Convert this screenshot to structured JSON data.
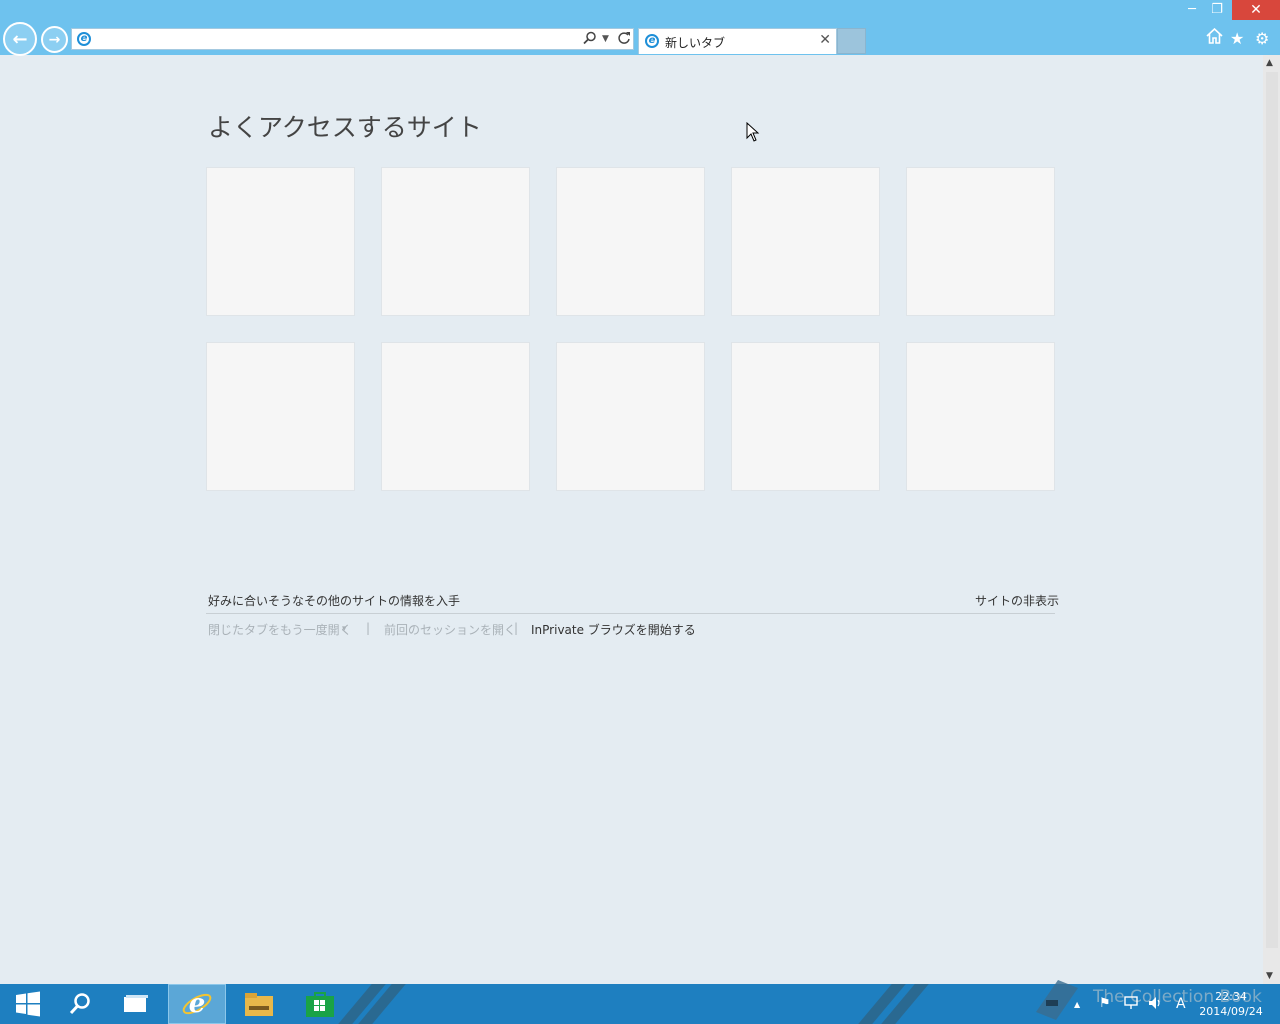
{
  "browser": {
    "address_value": "",
    "tab_title": "新しいタブ",
    "tab_close": "✕",
    "back": "←",
    "forward": "→",
    "search_icon": "search-icon",
    "refresh_icon": "refresh-icon"
  },
  "window": {
    "minimize": "─",
    "restore": "❐",
    "close": "✕"
  },
  "toolbar": {
    "home": "⌂",
    "favorites": "★",
    "settings": "⚙"
  },
  "page": {
    "heading": "よくアクセスするサイト",
    "tiles": [
      "",
      "",
      "",
      "",
      "",
      "",
      "",
      "",
      "",
      ""
    ],
    "more_sites": "好みに合いそうなその他のサイトの情報を入手",
    "hide_sites": "サイトの非表示",
    "reopen_closed": "閉じたタブをもう一度開く",
    "reopen_arrow": "▾",
    "reopen_session": "前回のセッションを開く",
    "inprivate": "InPrivate ブラウズを開始する",
    "separator": "|"
  },
  "taskbar": {
    "clock_time": "22:34",
    "clock_date": "2014/09/24",
    "ime": "A",
    "tray_arrow": "▲",
    "watermark": "The Collection Book"
  },
  "colors": {
    "chrome": "#6ec2ee",
    "content_bg": "#e4ecf2",
    "taskbar": "#1e7fc0",
    "close": "#d8473c"
  }
}
